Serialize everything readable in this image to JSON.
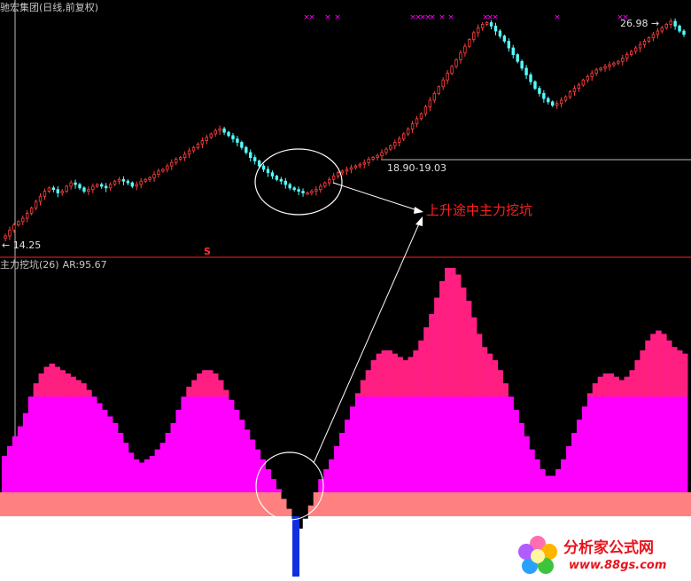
{
  "price_panel": {
    "title": "驰宏集团(日线,前复权)",
    "low_label": "14.25",
    "range_label": "18.90-19.03",
    "high_label": "26.98",
    "s_marker": "S",
    "annotation": "上升途中主力挖坑",
    "x_marks": [
      "×",
      "×",
      "×",
      "×",
      "×",
      "×",
      "×",
      "×",
      "×",
      "×",
      "×",
      "×",
      "×",
      "×",
      "×",
      "×",
      "×"
    ],
    "up_color": "#ff4040",
    "down_color": "#54ffff",
    "circle_color": "#ffffff",
    "arrow_color": "#ffffff",
    "line_color": "#ff2020",
    "x_mark_color": "#ff00ff"
  },
  "indicator_panel": {
    "title": "主力挖坑(26)",
    "ar_label": "AR:95.67",
    "main_color": "#ff00ff",
    "peak_color": "#ff1f7f",
    "base_color": "#ff8080",
    "floor_color": "#ffffff",
    "signal_color": "#1030e0"
  },
  "watermark": {
    "text": "分析家公式网",
    "url": "www.88gs.com"
  },
  "chart_data": {
    "type": "candlestick",
    "title": "驰宏集团(日线,前复权)",
    "annotations": [
      "上升途中主力挖坑",
      "14.25",
      "18.90-19.03",
      "26.98"
    ],
    "price_range": [
      14.25,
      26.98
    ],
    "closes": [
      14.25,
      14.6,
      14.9,
      15.1,
      15.3,
      15.6,
      15.9,
      16.3,
      16.6,
      16.9,
      17.1,
      17.0,
      16.8,
      16.9,
      17.2,
      17.4,
      17.3,
      17.1,
      16.9,
      17.0,
      17.2,
      17.3,
      17.2,
      17.1,
      17.3,
      17.5,
      17.6,
      17.5,
      17.4,
      17.2,
      17.3,
      17.5,
      17.6,
      17.7,
      17.9,
      18.1,
      18.2,
      18.4,
      18.6,
      18.8,
      18.9,
      19.1,
      19.3,
      19.5,
      19.7,
      19.9,
      20.1,
      20.3,
      20.5,
      20.6,
      20.4,
      20.2,
      20.0,
      19.8,
      19.5,
      19.2,
      18.9,
      18.7,
      18.4,
      18.2,
      18.0,
      17.8,
      17.6,
      17.5,
      17.3,
      17.1,
      17.0,
      16.9,
      16.8,
      16.8,
      16.9,
      17.0,
      17.2,
      17.4,
      17.6,
      17.8,
      18.0,
      18.1,
      18.2,
      18.3,
      18.4,
      18.5,
      18.6,
      18.8,
      18.9,
      19.0,
      19.2,
      19.4,
      19.6,
      19.8,
      20.0,
      20.3,
      20.6,
      20.9,
      21.2,
      21.5,
      21.9,
      22.3,
      22.7,
      23.1,
      23.5,
      23.9,
      24.3,
      24.7,
      25.1,
      25.5,
      25.9,
      26.3,
      26.6,
      26.8,
      26.9,
      26.7,
      26.4,
      26.1,
      25.8,
      25.4,
      25.0,
      24.6,
      24.2,
      23.8,
      23.4,
      23.0,
      22.7,
      22.4,
      22.2,
      22.0,
      22.1,
      22.3,
      22.5,
      22.8,
      23.0,
      23.2,
      23.5,
      23.7,
      23.9,
      24.1,
      24.2,
      24.3,
      24.4,
      24.5,
      24.6,
      24.8,
      25.0,
      25.2,
      25.4,
      25.6,
      25.8,
      26.0,
      26.2,
      26.4,
      26.6,
      26.8,
      26.98,
      26.7,
      26.4,
      26.2
    ],
    "indicator": {
      "name": "主力挖坑(26)",
      "AR": 95.67,
      "values": [
        22,
        28,
        34,
        40,
        48,
        58,
        66,
        72,
        76,
        78,
        76,
        74,
        72,
        70,
        68,
        66,
        62,
        58,
        54,
        50,
        46,
        42,
        36,
        30,
        24,
        20,
        18,
        20,
        22,
        26,
        30,
        36,
        42,
        50,
        58,
        64,
        68,
        72,
        74,
        74,
        72,
        68,
        62,
        56,
        50,
        44,
        38,
        32,
        26,
        20,
        14,
        8,
        2,
        -4,
        -10,
        -16,
        -22,
        -16,
        -8,
        0,
        8,
        14,
        20,
        28,
        36,
        44,
        52,
        60,
        68,
        74,
        80,
        84,
        86,
        86,
        84,
        82,
        80,
        82,
        86,
        92,
        100,
        108,
        118,
        128,
        136,
        136,
        132,
        124,
        116,
        106,
        96,
        88,
        84,
        80,
        74,
        66,
        58,
        50,
        42,
        34,
        26,
        20,
        14,
        10,
        10,
        14,
        20,
        28,
        36,
        44,
        52,
        60,
        66,
        70,
        72,
        72,
        70,
        68,
        70,
        74,
        80,
        86,
        92,
        96,
        98,
        96,
        92,
        88,
        86,
        84
      ]
    }
  }
}
